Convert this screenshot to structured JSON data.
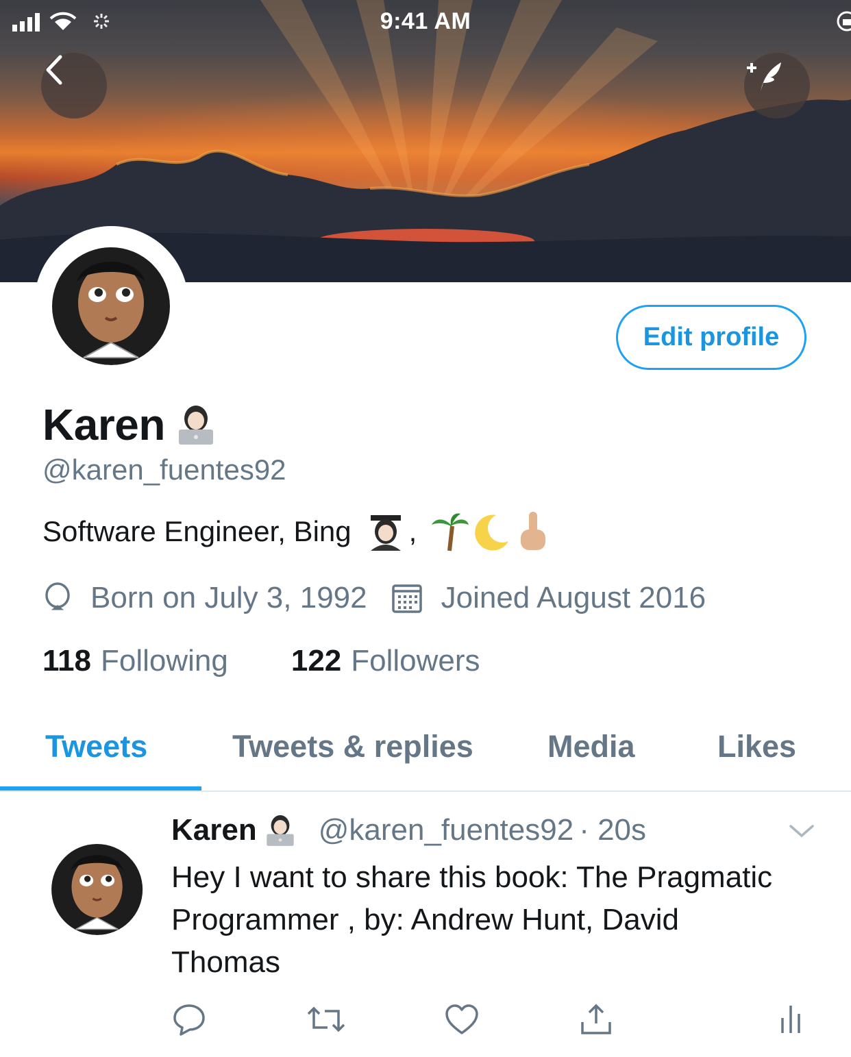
{
  "status_bar": {
    "time": "9:41 AM"
  },
  "profile": {
    "edit_label": "Edit profile",
    "name": "Karen",
    "handle": "@karen_fuentes92",
    "bio_text": "Software Engineer, Bing",
    "bio_comma": ",",
    "born": "Born on July 3, 1992",
    "joined": "Joined August 2016",
    "following_count": "118",
    "following_label": "Following",
    "followers_count": "122",
    "followers_label": "Followers"
  },
  "tabs": [
    {
      "label": "Tweets",
      "active": true
    },
    {
      "label": "Tweets & replies",
      "active": false
    },
    {
      "label": "Media",
      "active": false
    },
    {
      "label": "Likes",
      "active": false
    }
  ],
  "tweet": {
    "name": "Karen",
    "handle": "@karen_fuentes92",
    "time": "· 20s",
    "text": "Hey I want to share this book: The Pragmatic Programmer , by: Andrew Hunt, David Thomas"
  },
  "icons": [
    "back-icon",
    "compose-icon",
    "balloon-icon",
    "calendar-icon",
    "reply-icon",
    "retweet-icon",
    "like-icon",
    "share-icon",
    "analytics-icon",
    "chevron-down-icon"
  ],
  "colors": {
    "accent": "#1da1f2",
    "link": "#1b95e0",
    "secondary_text": "#657786"
  }
}
